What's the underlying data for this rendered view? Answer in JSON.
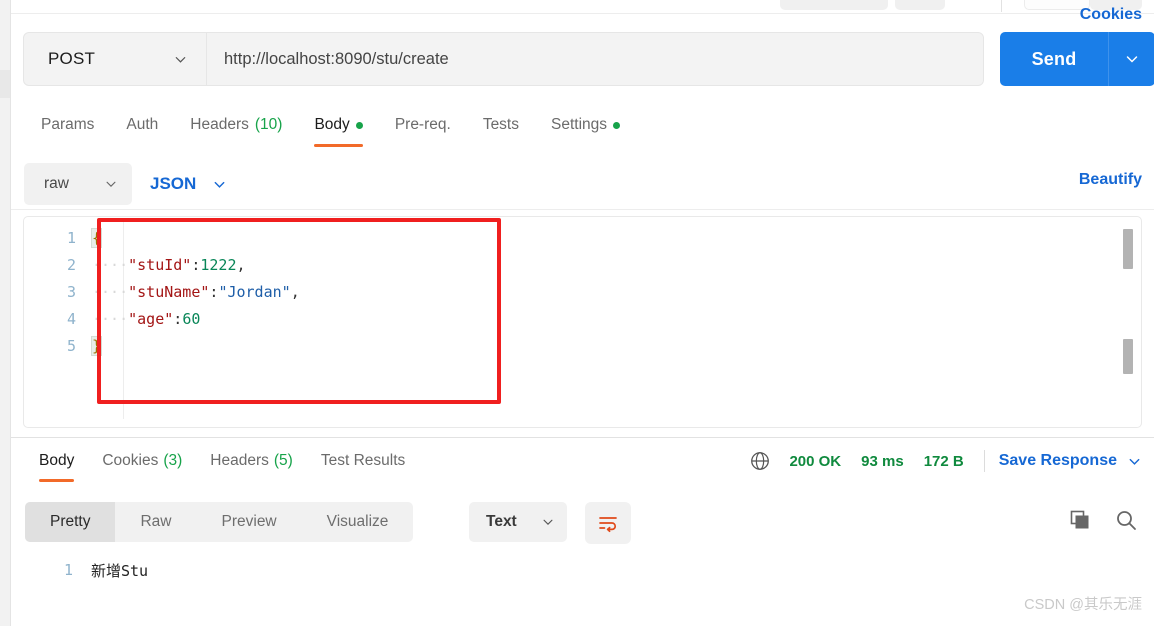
{
  "request": {
    "method": "POST",
    "url": "http://localhost:8090/stu/create",
    "send_label": "Send",
    "tabs": [
      {
        "label": "Params",
        "count": "",
        "dot": false,
        "active": false
      },
      {
        "label": "Auth",
        "count": "",
        "dot": false,
        "active": false
      },
      {
        "label": "Headers",
        "count": "(10)",
        "dot": false,
        "active": false
      },
      {
        "label": "Body",
        "count": "",
        "dot": true,
        "active": true
      },
      {
        "label": "Pre-req.",
        "count": "",
        "dot": false,
        "active": false
      },
      {
        "label": "Tests",
        "count": "",
        "dot": false,
        "active": false
      },
      {
        "label": "Settings",
        "count": "",
        "dot": true,
        "active": false
      }
    ],
    "cookies_link": "Cookies",
    "body_mode": "raw",
    "body_language": "JSON",
    "beautify_label": "Beautify"
  },
  "editor": {
    "lines": [
      {
        "num": "1",
        "indent": "",
        "parts": [
          {
            "t": "{",
            "k": "brace"
          }
        ]
      },
      {
        "num": "2",
        "indent": "····",
        "parts": [
          {
            "t": "\"stuId\"",
            "k": "key"
          },
          {
            "t": ":",
            "k": "punc"
          },
          {
            "t": "1222",
            "k": "num"
          },
          {
            "t": ",",
            "k": "punc"
          }
        ]
      },
      {
        "num": "3",
        "indent": "····",
        "parts": [
          {
            "t": "\"stuName\"",
            "k": "key"
          },
          {
            "t": ":",
            "k": "punc"
          },
          {
            "t": "\"Jordan\"",
            "k": "str"
          },
          {
            "t": ",",
            "k": "punc"
          }
        ]
      },
      {
        "num": "4",
        "indent": "····",
        "parts": [
          {
            "t": "\"age\"",
            "k": "key"
          },
          {
            "t": ":",
            "k": "punc"
          },
          {
            "t": "60",
            "k": "num"
          }
        ]
      },
      {
        "num": "5",
        "indent": "",
        "parts": [
          {
            "t": "}",
            "k": "brace"
          }
        ]
      }
    ]
  },
  "annotation": {
    "color": "#f01f1f",
    "shape": "rectangle"
  },
  "response": {
    "tabs": [
      {
        "label": "Body",
        "count": "",
        "active": true
      },
      {
        "label": "Cookies",
        "count": "(3)",
        "active": false
      },
      {
        "label": "Headers",
        "count": "(5)",
        "active": false
      },
      {
        "label": "Test Results",
        "count": "",
        "active": false
      }
    ],
    "status": "200 OK",
    "time": "93 ms",
    "size": "172 B",
    "save_label": "Save Response",
    "view_modes": [
      {
        "label": "Pretty",
        "active": true
      },
      {
        "label": "Raw",
        "active": false
      },
      {
        "label": "Preview",
        "active": false
      },
      {
        "label": "Visualize",
        "active": false
      }
    ],
    "format": "Text",
    "body_lines": [
      {
        "num": "1",
        "text": "新增Stu"
      }
    ]
  },
  "colors": {
    "accent_blue": "#1a7ee8",
    "link_blue": "#1668d4",
    "tab_orange": "#f26a29",
    "status_green": "#108a3e",
    "annotation_red": "#f01f1f"
  },
  "watermark": "CSDN @其乐无涯"
}
